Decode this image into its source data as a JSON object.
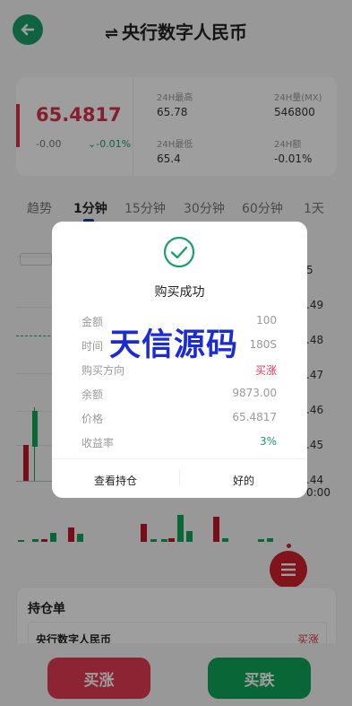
{
  "header": {
    "swap_glyph": "⇌",
    "title": "央行数字人民币",
    "back_icon": "arrow-left-icon"
  },
  "stats": {
    "price": "65.4817",
    "change_abs": "-0.00",
    "change_pct": "-0.01%",
    "high_label": "24H最高",
    "high_value": "65.78",
    "low_label": "24H最低",
    "low_value": "65.4",
    "volume_label": "24H量(MX)",
    "volume_value": "546800",
    "amount_label": "24H额",
    "amount_value": "-0.01%"
  },
  "tabs": [
    "趋势",
    "1分钟",
    "15分钟",
    "30分钟",
    "60分钟",
    "1天"
  ],
  "active_tab": "1分钟",
  "chart_data": {
    "type": "candlestick",
    "y_ticks": [
      "5",
      ".49",
      ".48",
      ".47",
      ".46",
      ".45",
      ".44"
    ],
    "time_label": "0:00"
  },
  "positions": {
    "title": "持仓单",
    "row_name": "央行数字人民币",
    "row_direction": "买涨"
  },
  "bottom": {
    "buy_up": "买涨",
    "buy_down": "买跌"
  },
  "dialog": {
    "title": "购买成功",
    "rows": [
      {
        "label": "金额",
        "value": "100"
      },
      {
        "label": "时间",
        "value": "180S"
      },
      {
        "label": "购买方向",
        "value": "买涨"
      },
      {
        "label": "余额",
        "value": "9873.00"
      },
      {
        "label": "价格",
        "value": "65.4817"
      },
      {
        "label": "收益率",
        "value": "3%"
      }
    ],
    "view_positions": "查看持仓",
    "ok": "好的"
  },
  "watermark": "天信源码",
  "colors": {
    "up": "#e23a55",
    "down": "#0fa65a",
    "accent": "#1aa06a"
  }
}
